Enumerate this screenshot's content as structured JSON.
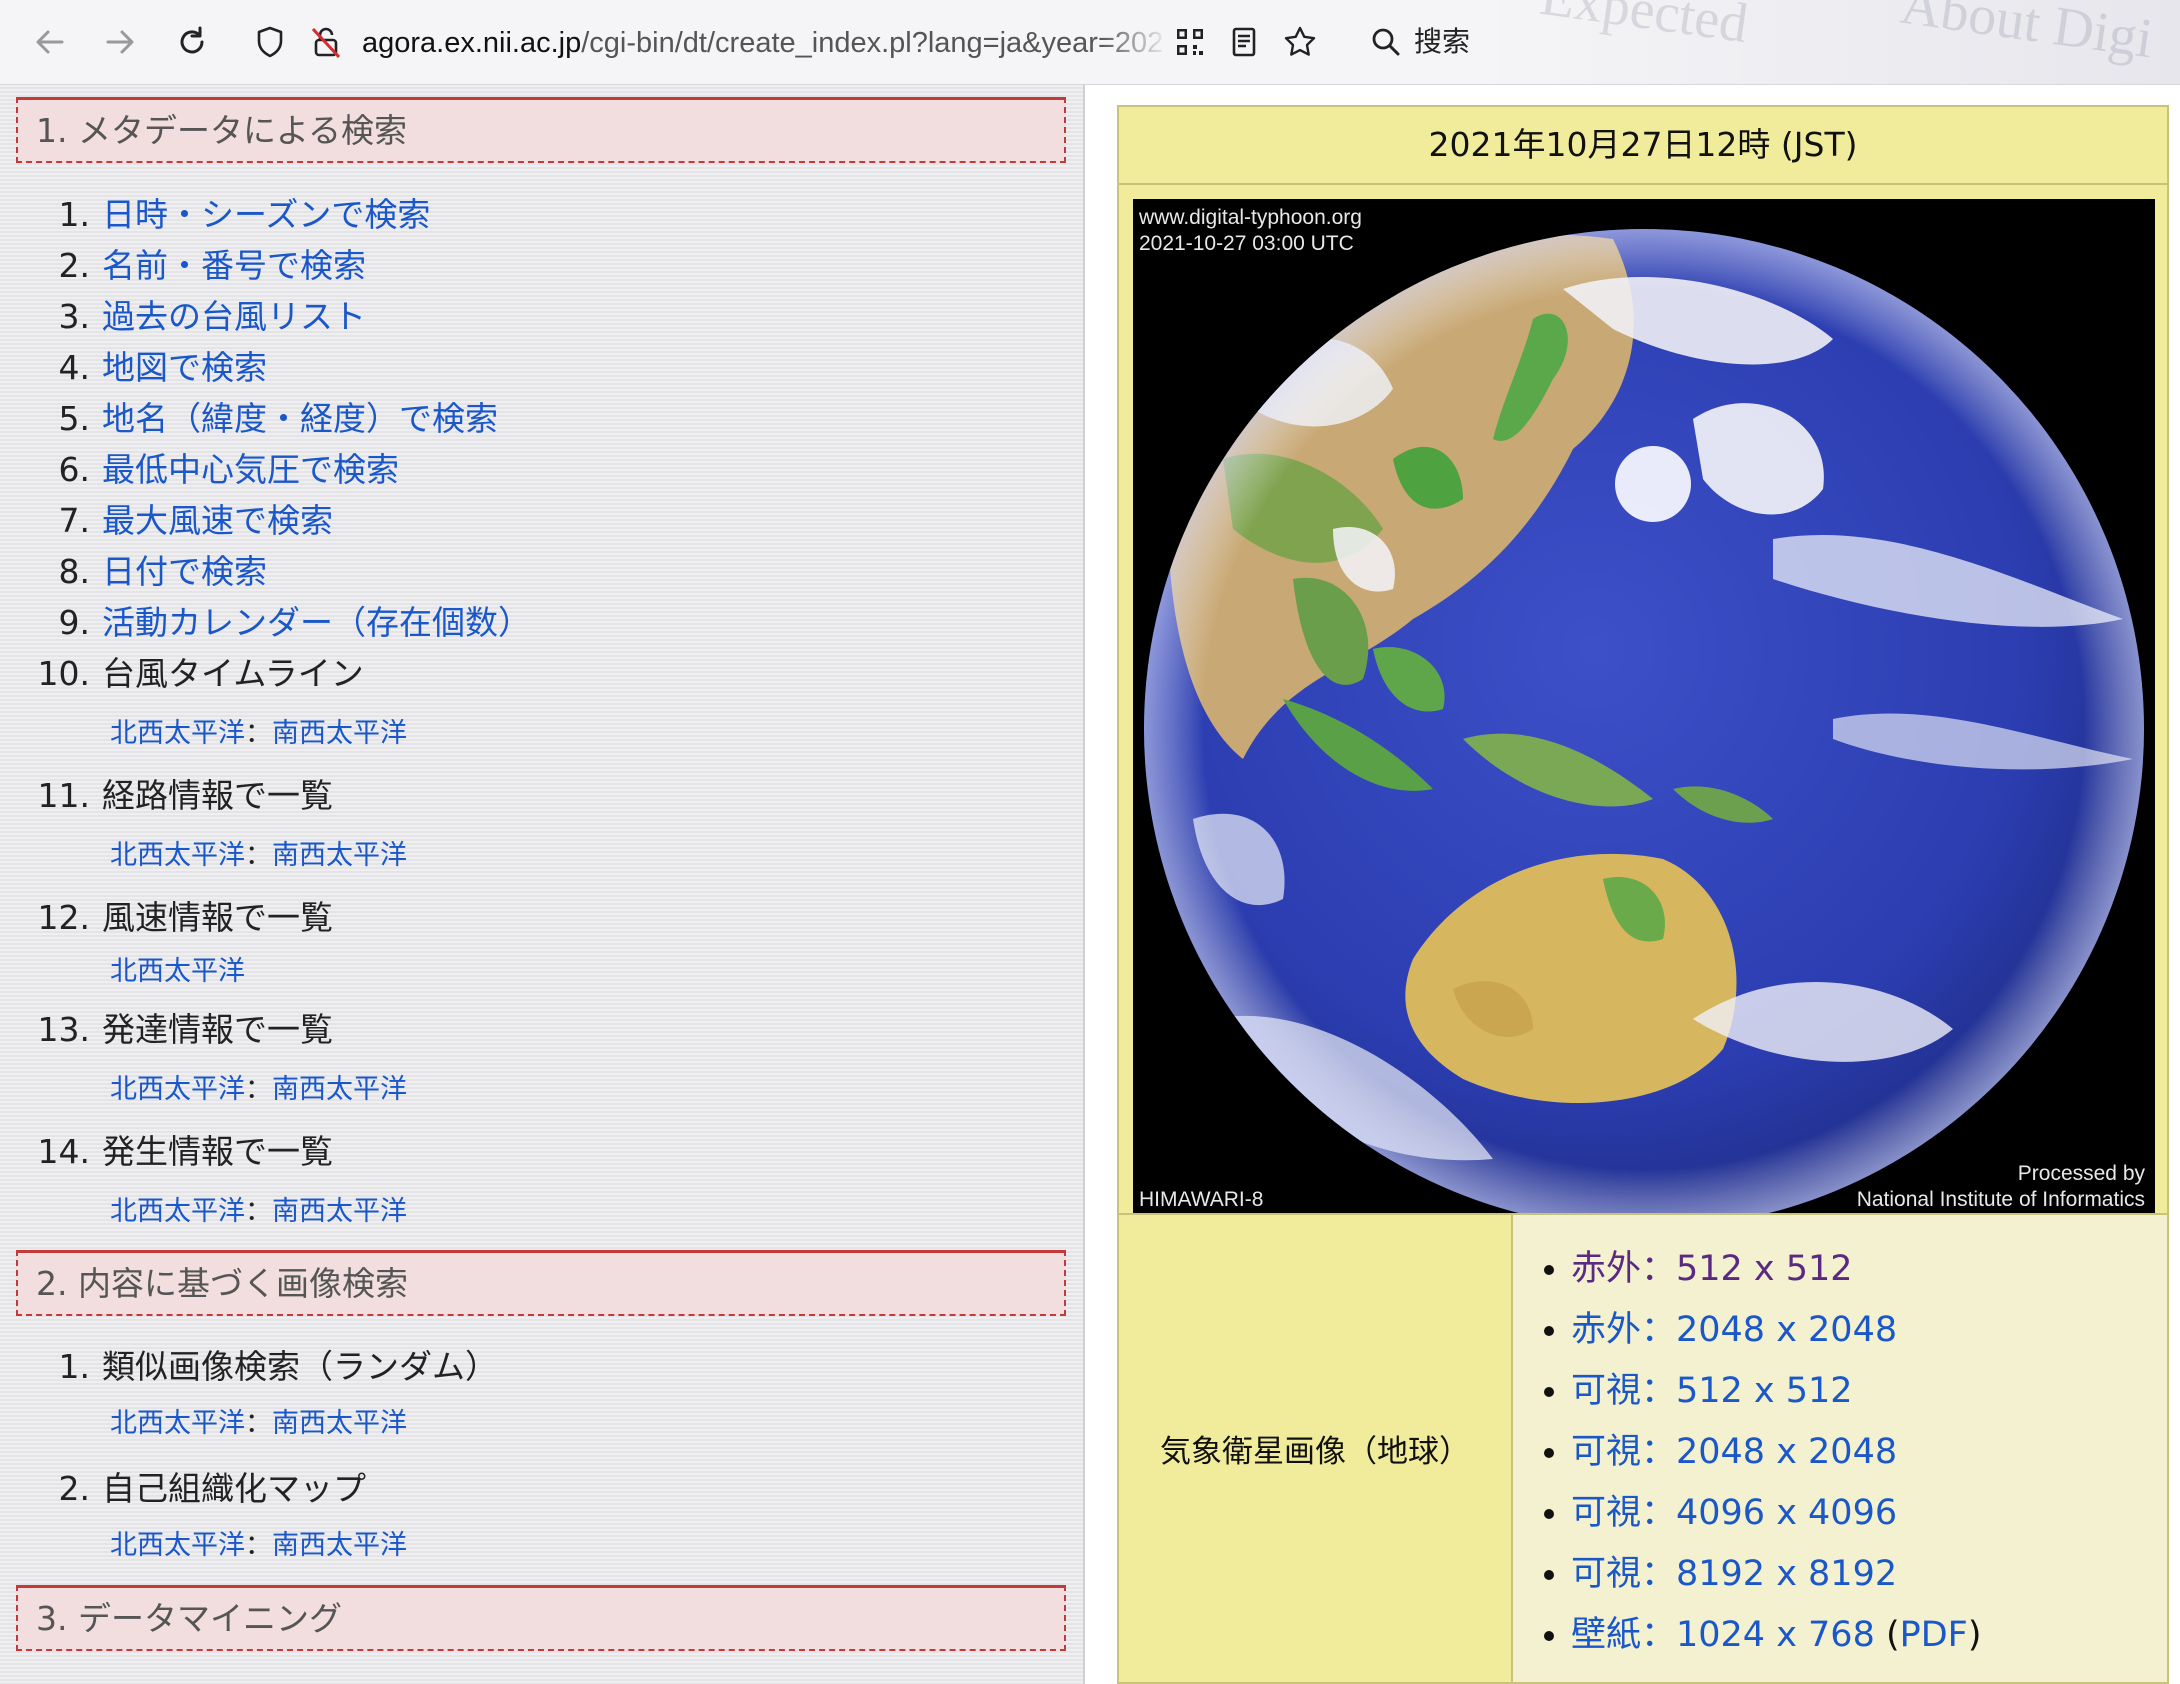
{
  "browser": {
    "url_host": "agora.ex.nii.ac.jp",
    "url_path": "/cgi-bin/dt/create_index.pl?lang=ja&year=202",
    "search_label": "搜索",
    "ghost_text": [
      "Expected",
      "About Digi"
    ]
  },
  "sections": [
    {
      "title": "1. メタデータによる検索",
      "items": [
        {
          "num": "1.",
          "label": "日時・シーズンで検索",
          "link": true
        },
        {
          "num": "2.",
          "label": "名前・番号で検索",
          "link": true
        },
        {
          "num": "3.",
          "label": "過去の台風リスト",
          "link": true
        },
        {
          "num": "4.",
          "label": "地図で検索",
          "link": true
        },
        {
          "num": "5.",
          "label": "地名（緯度・経度）で検索",
          "link": true
        },
        {
          "num": "6.",
          "label": "最低中心気圧で検索",
          "link": true
        },
        {
          "num": "7.",
          "label": "最大風速で検索",
          "link": true
        },
        {
          "num": "8.",
          "label": "日付で検索",
          "link": true
        },
        {
          "num": "9.",
          "label": "活動カレンダー（存在個数）",
          "link": true
        },
        {
          "num": "10.",
          "label": "台風タイムライン",
          "link": false,
          "subs": [
            "北西太平洋",
            "南西太平洋"
          ]
        },
        {
          "num": "11.",
          "label": "経路情報で一覧",
          "link": false,
          "subs": [
            "北西太平洋",
            "南西太平洋"
          ]
        },
        {
          "num": "12.",
          "label": "風速情報で一覧",
          "link": false,
          "subs": [
            "北西太平洋"
          ]
        },
        {
          "num": "13.",
          "label": "発達情報で一覧",
          "link": false,
          "subs": [
            "北西太平洋",
            "南西太平洋"
          ]
        },
        {
          "num": "14.",
          "label": "発生情報で一覧",
          "link": false,
          "subs": [
            "北西太平洋",
            "南西太平洋"
          ]
        }
      ]
    },
    {
      "title": "2. 内容に基づく画像検索",
      "items": [
        {
          "num": "1.",
          "label": "類似画像検索（ランダム）",
          "link": false,
          "subs": [
            "北西太平洋",
            "南西太平洋"
          ]
        },
        {
          "num": "2.",
          "label": "自己組織化マップ",
          "link": false,
          "subs": [
            "北西太平洋",
            "南西太平洋"
          ]
        }
      ]
    },
    {
      "title": "3. データマイニング",
      "items": []
    }
  ],
  "sub_separator": "：",
  "right": {
    "date_heading": "2021年10月27日12時 (JST)",
    "image_text": {
      "top_line1": "www.digital-typhoon.org",
      "top_line2": "2021-10-27 03:00 UTC",
      "bottom_left": "HIMAWARI-8",
      "bottom_right1": "Processed by",
      "bottom_right2": "National Institute of Informatics"
    },
    "row_label": "気象衛星画像（地球）",
    "downloads": [
      {
        "text": "赤外：512 x 512",
        "visited": true
      },
      {
        "text": "赤外：2048 x 2048",
        "visited": false
      },
      {
        "text": "可視：512 x 512",
        "visited": false
      },
      {
        "text": "可視：2048 x 2048",
        "visited": false
      },
      {
        "text": "可視：4096 x 4096",
        "visited": false
      },
      {
        "text": "可視：8192 x 8192",
        "visited": false
      },
      {
        "text": "壁紙：1024 x 768",
        "visited": false,
        "extra": "PDF"
      }
    ]
  }
}
